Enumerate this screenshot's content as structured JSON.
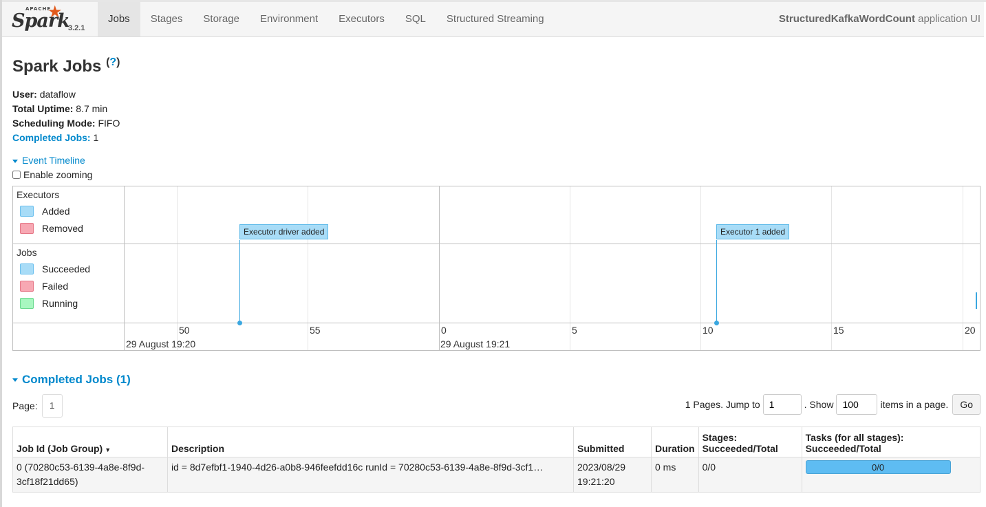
{
  "nav": {
    "logo_apache": "APACHE",
    "logo_text": "Spark",
    "version": "3.2.1",
    "tabs": [
      "Jobs",
      "Stages",
      "Storage",
      "Environment",
      "Executors",
      "SQL",
      "Structured Streaming"
    ],
    "active_tab": "Jobs",
    "app_name": "StructuredKafkaWordCount",
    "app_suffix": " application UI"
  },
  "page": {
    "title": "Spark Jobs",
    "help": "?",
    "user_label": "User:",
    "user_value": "dataflow",
    "uptime_label": "Total Uptime:",
    "uptime_value": "8.7 min",
    "scheduling_label": "Scheduling Mode:",
    "scheduling_value": "FIFO",
    "completed_label": "Completed Jobs:",
    "completed_value": "1"
  },
  "timeline": {
    "toggle_label": "Event Timeline",
    "zoom_label": "Enable zooming",
    "executors_group": "Executors",
    "executors_legend": [
      "Added",
      "Removed"
    ],
    "jobs_group": "Jobs",
    "jobs_legend": [
      "Succeeded",
      "Failed",
      "Running"
    ],
    "events": [
      "Executor driver added",
      "Executor 1 added"
    ],
    "ticks": [
      "50",
      "55",
      "0",
      "5",
      "10",
      "15",
      "20"
    ],
    "date_labels": [
      "29 August 19:20",
      "29 August 19:21"
    ],
    "colors": {
      "added": "#a8dcf7",
      "removed": "#f7a8b3",
      "running": "#a8f7c0",
      "accent": "#0088cc"
    }
  },
  "completed": {
    "header": "Completed Jobs (1)",
    "page_label": "Page:",
    "current_page": "1",
    "pages_text": "1 Pages. Jump to",
    "jump_value": "1",
    "show_text": ". Show",
    "show_value": "100",
    "items_text": "items in a page.",
    "go_label": "Go",
    "columns": [
      "Job Id (Job Group)",
      "Description",
      "Submitted",
      "Duration",
      "Stages: Succeeded/Total",
      "Tasks (for all stages): Succeeded/Total"
    ],
    "rows": [
      {
        "job_id": "0 (70280c53-6139-4a8e-8f9d-3cf18f21dd65)",
        "description": "id = 8d7efbf1-1940-4d26-a0b8-946feefdd16c runId = 70280c53-6139-4a8e-8f9d-3cf1…",
        "submitted": "2023/08/29 19:21:20",
        "duration": "0 ms",
        "stages": "0/0",
        "tasks": "0/0",
        "tasks_progress": 0.0
      }
    ]
  }
}
